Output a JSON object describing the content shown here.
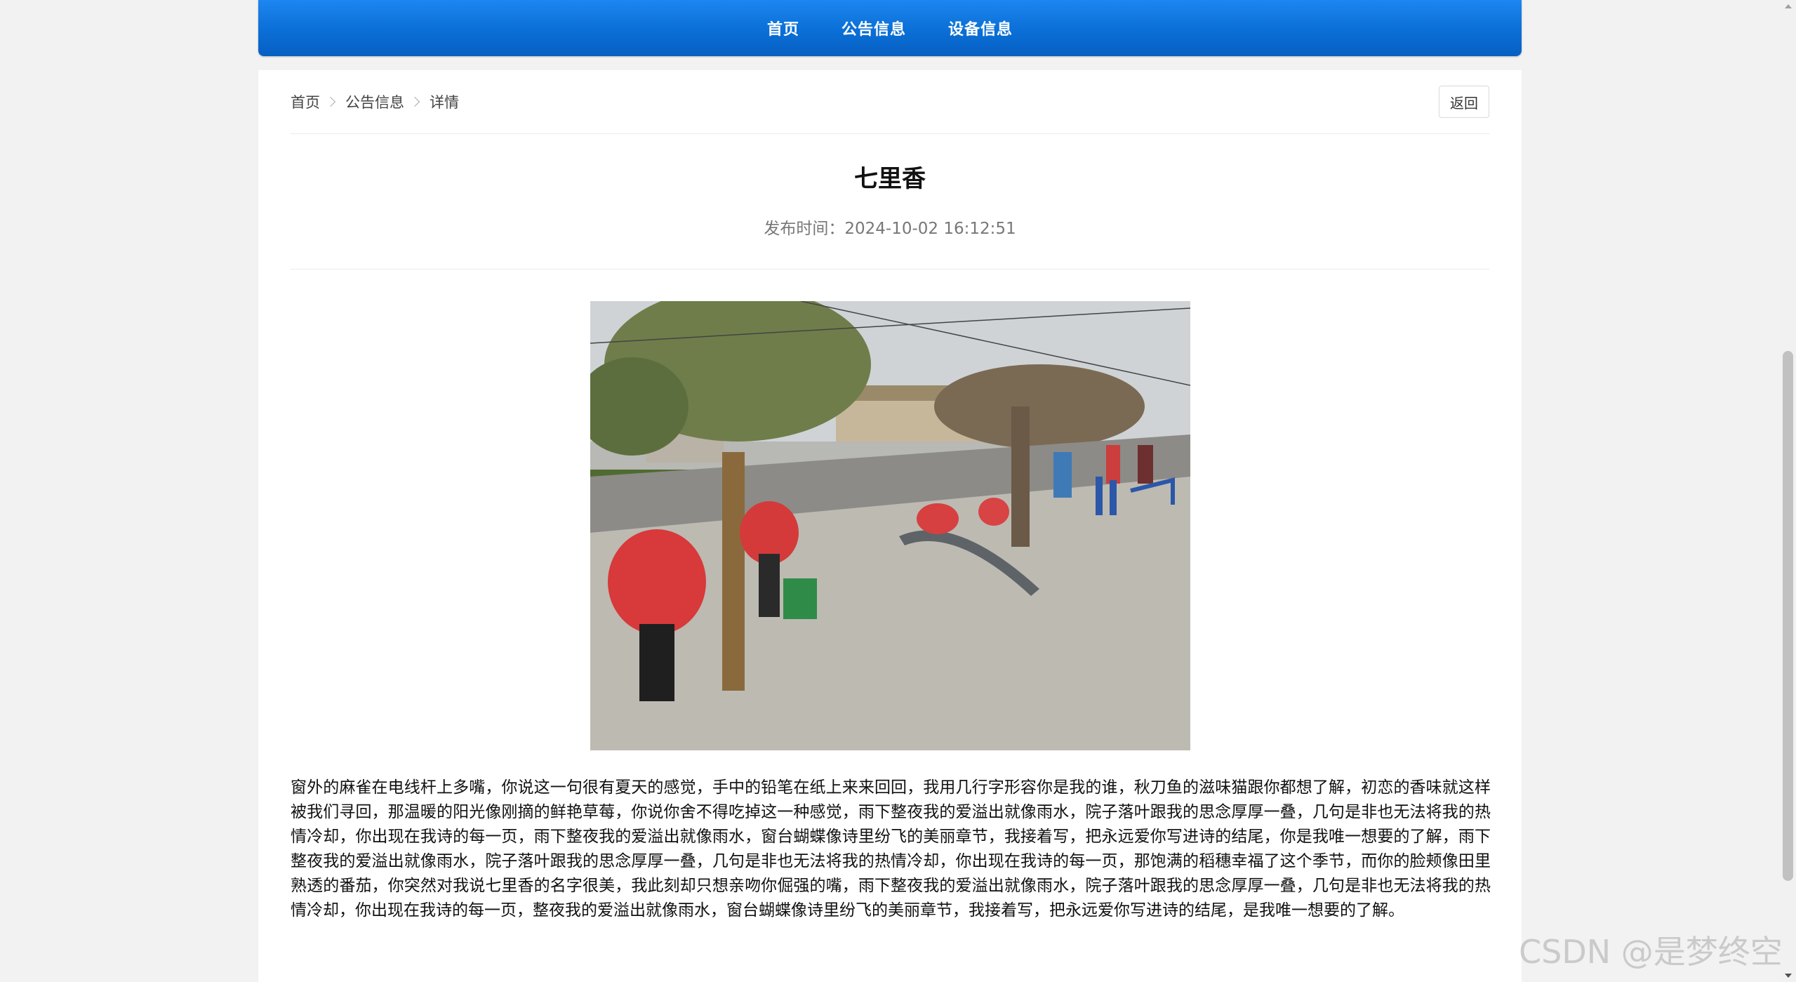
{
  "nav": {
    "items": [
      {
        "label": "首页"
      },
      {
        "label": "公告信息"
      },
      {
        "label": "设备信息"
      }
    ]
  },
  "breadcrumb": {
    "items": [
      "首页",
      "公告信息",
      "详情"
    ]
  },
  "back_label": "返回",
  "article": {
    "title": "七里香",
    "publish_label": "发布时间：",
    "publish_time": "2024-10-02 16:12:51",
    "image_icon": "photo-volunteers-cleaning-fitness-equipment",
    "body": "窗外的麻雀在电线杆上多嘴，你说这一句很有夏天的感觉，手中的铅笔在纸上来来回回，我用几行字形容你是我的谁，秋刀鱼的滋味猫跟你都想了解，初恋的香味就这样被我们寻回，那温暖的阳光像刚摘的鲜艳草莓，你说你舍不得吃掉这一种感觉，雨下整夜我的爱溢出就像雨水，院子落叶跟我的思念厚厚一叠，几句是非也无法将我的热情冷却，你出现在我诗的每一页，雨下整夜我的爱溢出就像雨水，窗台蝴蝶像诗里纷飞的美丽章节，我接着写，把永远爱你写进诗的结尾，你是我唯一想要的了解，雨下整夜我的爱溢出就像雨水，院子落叶跟我的思念厚厚一叠，几句是非也无法将我的热情冷却，你出现在我诗的每一页，那饱满的稻穗幸福了这个季节，而你的脸颊像田里熟透的番茄，你突然对我说七里香的名字很美，我此刻却只想亲吻你倔强的嘴，雨下整夜我的爱溢出就像雨水，院子落叶跟我的思念厚厚一叠，几句是非也无法将我的热情冷却，你出现在我诗的每一页，整夜我的爱溢出就像雨水，窗台蝴蝶像诗里纷飞的美丽章节，我接着写，把永远爱你写进诗的结尾，是我唯一想要的了解。"
  },
  "watermark": "CSDN @是梦终空",
  "colors": {
    "nav_blue": "#0a6fd6",
    "background": "#f2f2f2"
  }
}
